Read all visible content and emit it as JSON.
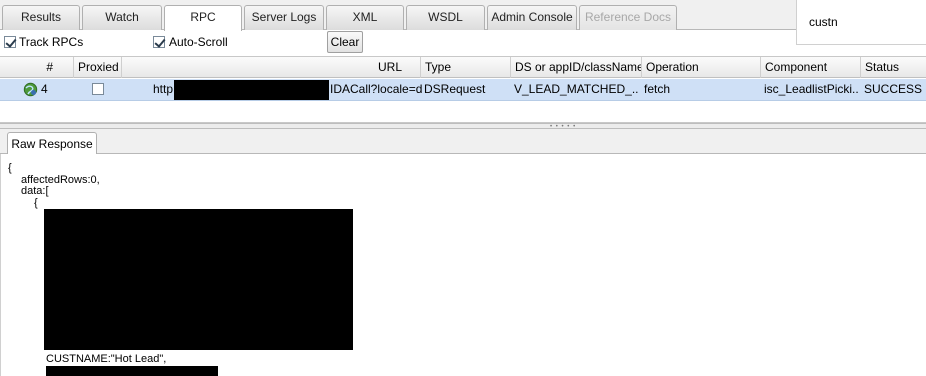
{
  "tabs": [
    {
      "label": "Results",
      "state": "normal"
    },
    {
      "label": "Watch",
      "state": "normal"
    },
    {
      "label": "RPC",
      "state": "active"
    },
    {
      "label": "Server Logs",
      "state": "normal"
    },
    {
      "label": "XML",
      "state": "normal"
    },
    {
      "label": "WSDL",
      "state": "normal"
    },
    {
      "label": "Admin Console",
      "state": "normal"
    },
    {
      "label": "Reference Docs",
      "state": "disabled"
    }
  ],
  "search": {
    "value": "custn"
  },
  "toolbar": {
    "track_rpcs_label": "Track RPCs",
    "track_rpcs_checked": true,
    "auto_scroll_label": "Auto-Scroll",
    "auto_scroll_checked": true,
    "clear_label": "Clear"
  },
  "grid": {
    "columns": [
      "#",
      "Proxied",
      "URL",
      "Type",
      "DS or appID/className",
      "Operation",
      "Component",
      "Status"
    ],
    "rows": [
      {
        "icon": "rpc-request-icon",
        "number": "4",
        "proxied": false,
        "url_prefix": "http:",
        "url_suffix": "IDACall?locale=de",
        "type": "DSRequest",
        "ds": "V_LEAD_MATCHED_...",
        "operation": "fetch",
        "component": "isc_LeadlistPicki...",
        "status": "SUCCESS"
      }
    ]
  },
  "response_tab": {
    "label": "Raw Response"
  },
  "response": {
    "line_open": "{",
    "line_affected": "affectedRows:0,",
    "line_data": "data:[",
    "line_obj_open": "{",
    "line_custname": "CUSTNAME:\"Hot Lead\","
  },
  "colors": {
    "selected_row": "#cfe0f6",
    "redaction": "#000000"
  }
}
